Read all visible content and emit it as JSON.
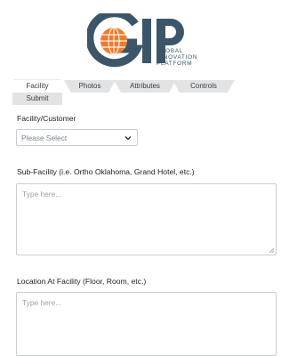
{
  "logo": {
    "letters": "GIP",
    "line1": "GLOBAL",
    "line2": "INNOVATION",
    "line3": "PLATFORM",
    "colors": {
      "dark": "#3d5568",
      "orange": "#ef7b2d"
    }
  },
  "tabs": [
    {
      "label": "Facility",
      "active": true
    },
    {
      "label": "Photos"
    },
    {
      "label": "Attributes"
    },
    {
      "label": "Controls"
    },
    {
      "label": "Submit"
    }
  ],
  "form": {
    "facility_label": "Facility/Customer",
    "facility_select": {
      "value": "Please Select",
      "icon": "chevron-down-icon"
    },
    "subfacility_label": "Sub-Facility (i.e. Ortho Oklahoma, Grand Hotel, etc.)",
    "subfacility_placeholder": "Type here...",
    "location_label": "Location At Facility (Floor, Room, etc.)",
    "location_placeholder": "Type here..."
  }
}
